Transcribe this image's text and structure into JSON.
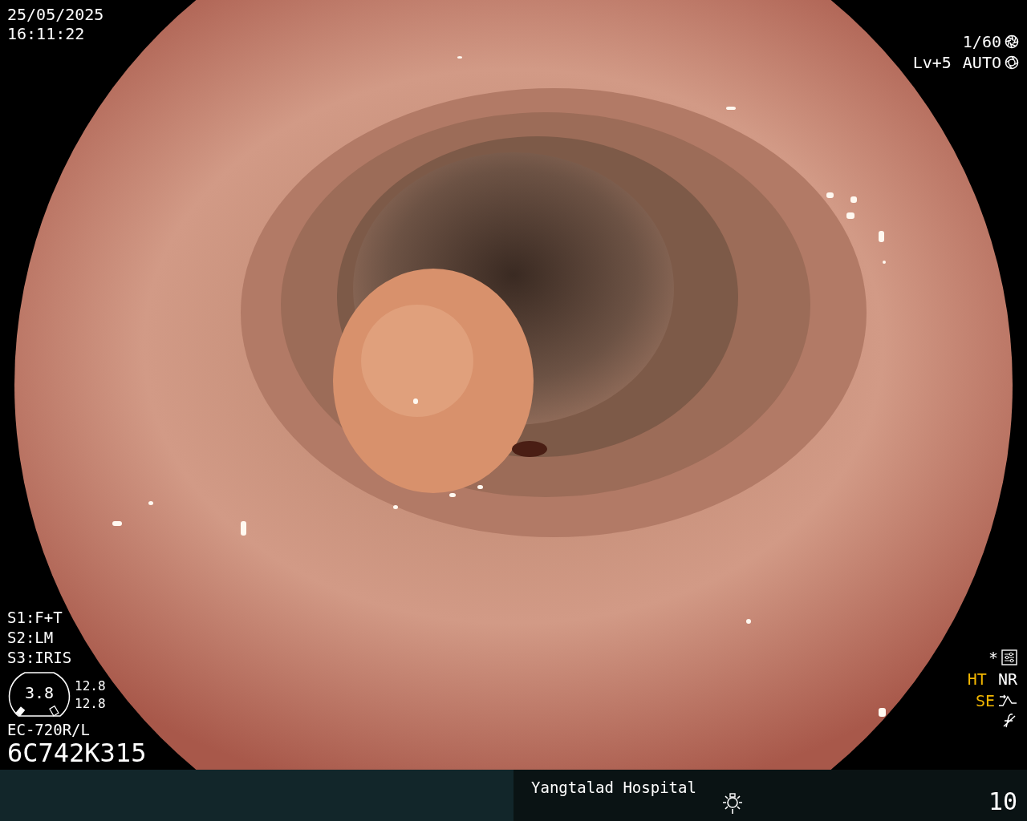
{
  "datetime": {
    "date": "25/05/2025",
    "time": "16:11:22"
  },
  "exposure": {
    "shutter": "1/60",
    "level": "Lv+5",
    "iris": "AUTO"
  },
  "switches": [
    "S1:F+T",
    "S2:LM",
    "S3:IRIS"
  ],
  "gauge": {
    "value": "3.8",
    "readings": [
      "12.8",
      "12.8"
    ]
  },
  "scope": {
    "model": "EC-720R/L",
    "serial": "6C742K315"
  },
  "indicators": {
    "star": "*",
    "items": [
      {
        "label": "HT",
        "color": "#f2b600"
      },
      {
        "label": "NR",
        "color": "#ffffff"
      },
      {
        "label": "SE",
        "color": "#f2b600"
      }
    ]
  },
  "status_bar": {
    "hospital": "Yangtalad Hospital",
    "page": "10"
  }
}
